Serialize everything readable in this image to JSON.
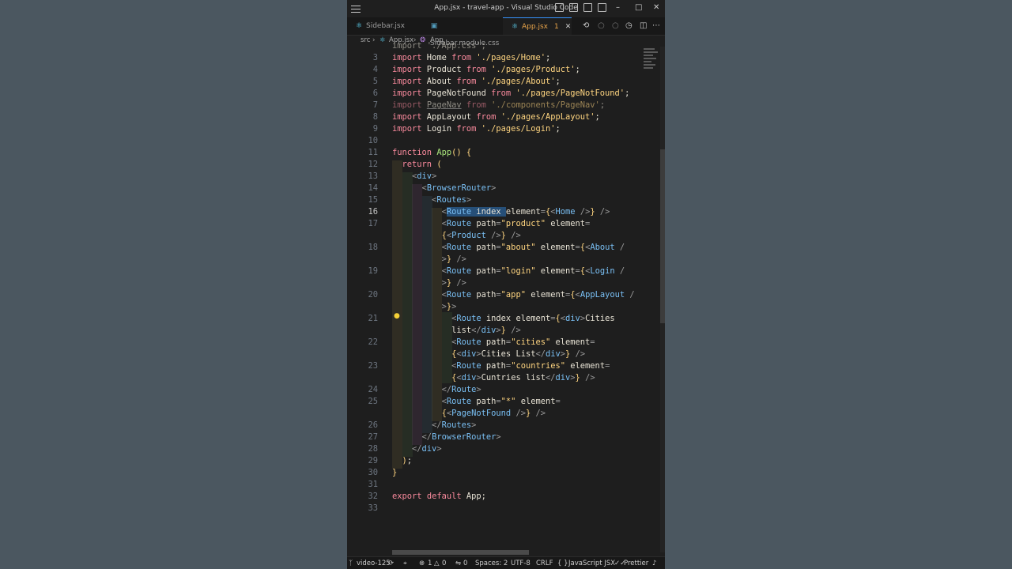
{
  "window": {
    "title": "App.jsx - travel-app - Visual Studio Code"
  },
  "tabs": [
    {
      "label": "Sidebar.jsx",
      "icon": "react-icon"
    },
    {
      "label": "Sidebar.module.css",
      "icon": "css-icon"
    },
    {
      "label": "App.jsx",
      "icon": "react-icon",
      "badge": "1",
      "active": true
    }
  ],
  "breadcrumb": {
    "folder": "src",
    "file": "App.jsx",
    "symbol": "App"
  },
  "editor": {
    "current_line": "16",
    "top_partial": "import './App.css';",
    "line_numbers": [
      "3",
      "4",
      "5",
      "6",
      "7",
      "8",
      "9",
      "10",
      "11",
      "12",
      "13",
      "14",
      "15",
      "16",
      "17",
      "18",
      "19",
      "20",
      "21",
      "22",
      "23",
      "24",
      "25",
      "26",
      "27",
      "28",
      "29",
      "30",
      "31",
      "32",
      "33"
    ]
  },
  "statusbar": {
    "branch": "video-125",
    "problems_errors": "1",
    "problems_warnings": "0",
    "ports": "0",
    "spaces": "Spaces: 2",
    "encoding": "UTF-8",
    "eol": "CRLF",
    "language": "JavaScript JSX",
    "formatter": "Prettier"
  },
  "colors": {
    "accent": "#3794ff",
    "editor_bg": "#1e1e1e",
    "active_tab_text": "#e8a44a"
  }
}
